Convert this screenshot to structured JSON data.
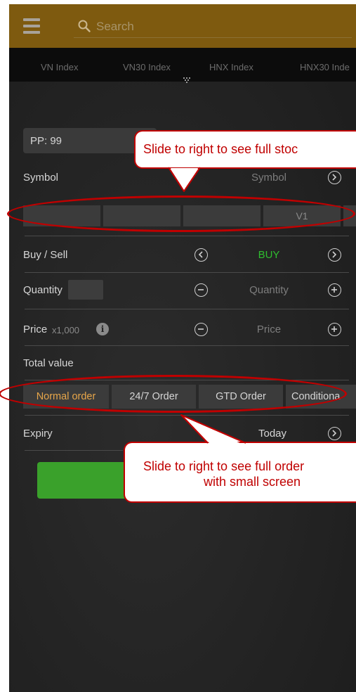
{
  "header": {
    "search_placeholder": "Search",
    "index_tabs": [
      "VN Index",
      "VN30 Index",
      "HNX Index",
      "HNX30 Inde"
    ]
  },
  "form": {
    "purchasing_power": "PP: 99",
    "symbol_label": "Symbol",
    "symbol_placeholder": "Symbol",
    "price_cells": [
      "",
      "",
      "",
      "V1"
    ],
    "buy_sell_label": "Buy / Sell",
    "side_value": "BUY",
    "quantity_label": "Quantity",
    "quantity_placeholder": "Quantity",
    "price_label": "Price",
    "price_unit": "x1,000",
    "price_placeholder": "Price",
    "total_value_label": "Total value",
    "order_tabs": [
      "Normal order",
      "24/7 Order",
      "GTD Order",
      "Conditiona"
    ],
    "active_order_tab": "Normal order",
    "expiry_label": "Expiry",
    "expiry_value": "Today"
  },
  "annotations": {
    "callout_stock": "Slide to right to see full stoc",
    "callout_order_line1": "Slide to right to see full order",
    "callout_order_line2": "with small screen"
  },
  "colors": {
    "header_bg": "#7e5a0f",
    "buy_green": "#3aa12b",
    "active_tab_orange": "#e7a64a",
    "annotation_red": "#c00000"
  }
}
